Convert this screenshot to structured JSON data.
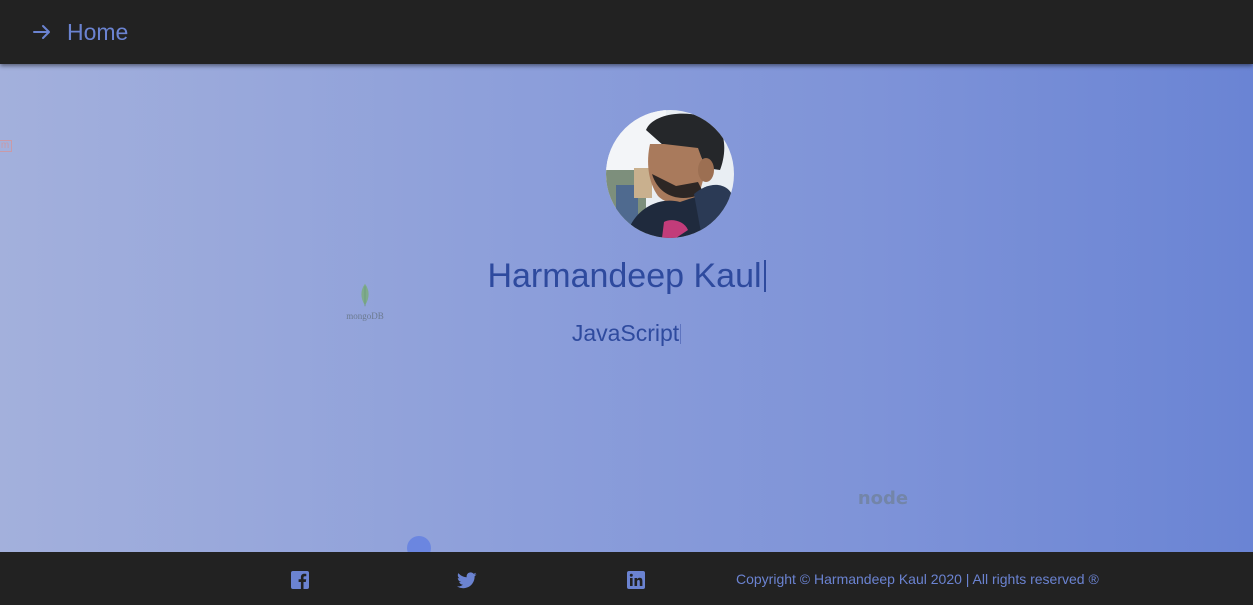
{
  "nav": {
    "home_label": "Home",
    "icon": "arrow-right-icon"
  },
  "profile": {
    "name": "Harmandeep Kaul",
    "skill": "JavaScript"
  },
  "floating_logos": {
    "mongo_label": "mongoDB",
    "node_label": "node"
  },
  "footer": {
    "social": [
      "facebook-icon",
      "twitter-icon",
      "linkedin-icon"
    ],
    "copyright": "Copyright © Harmandeep Kaul 2020 | All rights reserved ®"
  },
  "colors": {
    "bar_bg": "#222222",
    "accent": "#6b83d1",
    "name_text": "#2e4a9e"
  }
}
